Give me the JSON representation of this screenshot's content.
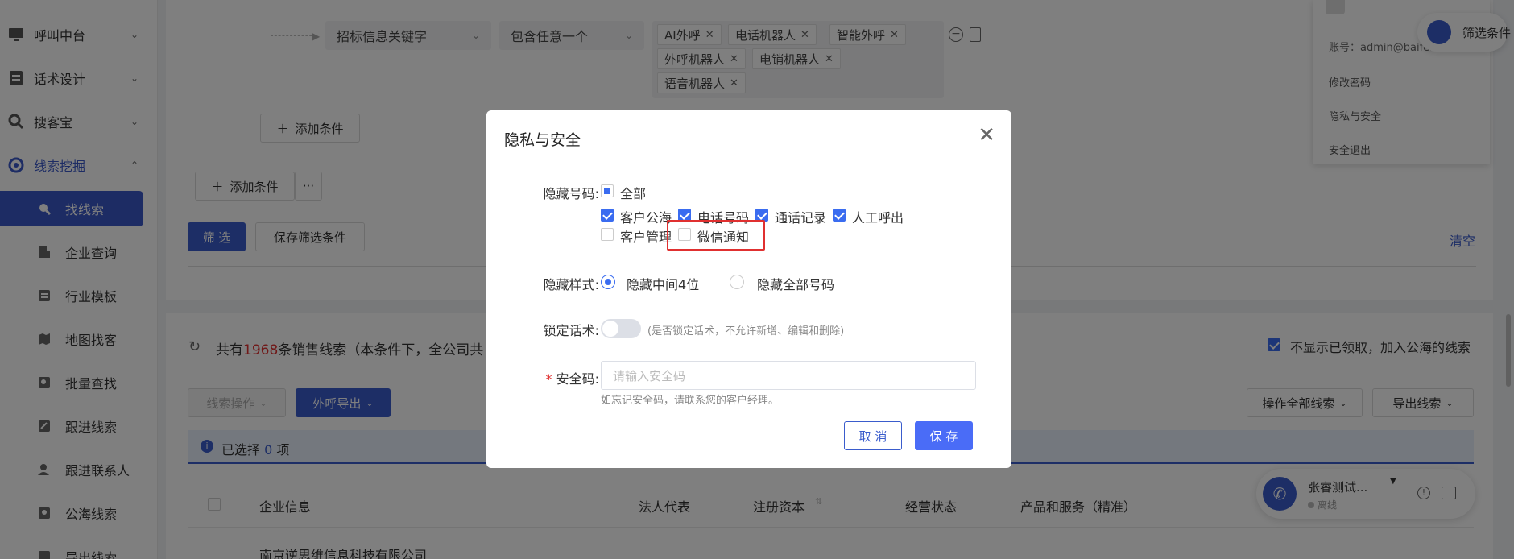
{
  "sidebar": {
    "menus": [
      {
        "label": "呼叫中台",
        "icon": "monitor-icon"
      },
      {
        "label": "话术设计",
        "icon": "document-icon"
      },
      {
        "label": "搜客宝",
        "icon": "search-icon"
      },
      {
        "label": "线索挖掘",
        "icon": "target-icon"
      }
    ],
    "sub_items": [
      {
        "label": "找线索",
        "icon": "search-icon"
      },
      {
        "label": "企业查询",
        "icon": "building-icon"
      },
      {
        "label": "行业模板",
        "icon": "template-icon"
      },
      {
        "label": "地图找客",
        "icon": "map-icon"
      },
      {
        "label": "批量查找",
        "icon": "batch-search-icon"
      },
      {
        "label": "跟进线索",
        "icon": "edit-icon"
      },
      {
        "label": "跟进联系人",
        "icon": "contact-icon"
      },
      {
        "label": "公海线索",
        "icon": "pool-icon"
      },
      {
        "label": "导出线索",
        "icon": "export-icon"
      }
    ]
  },
  "filter": {
    "field": "招标信息关键字",
    "operator": "包含任意一个",
    "tags": [
      "AI外呼",
      "电话机器人",
      "智能外呼",
      "外呼机器人",
      "电销机器人",
      "语音机器人"
    ],
    "add_condition_inner": "添加条件",
    "add_condition": "添加条件",
    "more": "···",
    "filter_button": "筛 选",
    "save_filter": "保存筛选条件",
    "clear": "清空",
    "top_right_button": "筛选条件"
  },
  "results": {
    "prefix": "共有",
    "count": "1968",
    "suffix": "条销售线索（本条件下，全公司共",
    "hide_claimed": "不显示已领取，加入公海的线索",
    "lead_ops": "线索操作",
    "outbound_export": "外呼导出",
    "op_all": "操作全部线索",
    "export_leads": "导出线索",
    "selected_prefix": "已选择",
    "selected_count": "0",
    "selected_suffix": "项",
    "columns": [
      "企业信息",
      "法人代表",
      "注册资本",
      "经营状态",
      "产品和服务（精准）"
    ],
    "first_row": "南京逆思维信息科技有限公司"
  },
  "dropdown_menu": {
    "items": [
      "账号：admin@baifen",
      "修改密码",
      "隐私与安全",
      "安全退出"
    ]
  },
  "call_widget": {
    "name": "张睿测试...",
    "status": "离线"
  },
  "modal": {
    "title": "隐私与安全",
    "hide_number_label": "隐藏号码:",
    "all_label": "全部",
    "options": [
      {
        "label": "客户公海",
        "checked": true
      },
      {
        "label": "电话号码",
        "checked": true
      },
      {
        "label": "通话记录",
        "checked": true
      },
      {
        "label": "人工呼出",
        "checked": true
      },
      {
        "label": "客户管理",
        "checked": false
      },
      {
        "label": "微信通知",
        "checked": false
      }
    ],
    "hide_style_label": "隐藏样式:",
    "style_options": [
      "隐藏中间4位",
      "隐藏全部号码"
    ],
    "lock_label": "锁定话术:",
    "lock_hint": "(是否锁定话术，不允许新增、编辑和删除)",
    "security_label": "安全码:",
    "required_mark": "*",
    "security_placeholder": "请输入安全码",
    "security_hint": "如忘记安全码，请联系您的客户经理。",
    "cancel": "取 消",
    "save": "保 存"
  },
  "colors": {
    "primary": "#3a5ccc",
    "highlight": "#e03030",
    "count_red": "#e03030"
  }
}
